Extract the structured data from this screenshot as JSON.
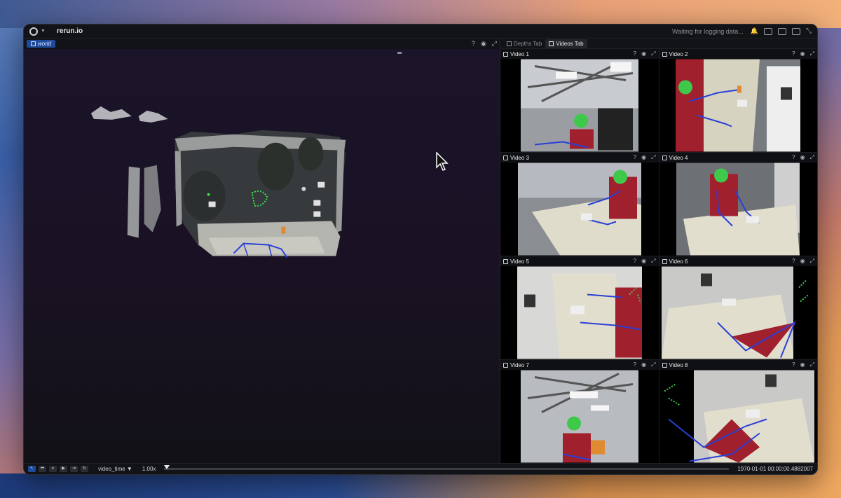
{
  "app": {
    "title": "rerun.io",
    "status": "Waiting for logging data..."
  },
  "world_view": {
    "tab_label": "world"
  },
  "tabs": [
    {
      "label": "Depths Tab",
      "active": false
    },
    {
      "label": "Videos Tab",
      "active": true
    }
  ],
  "videos": [
    {
      "label": "Video 1",
      "scene": "ceiling"
    },
    {
      "label": "Video 2",
      "scene": "side-table"
    },
    {
      "label": "Video 3",
      "scene": "front"
    },
    {
      "label": "Video 4",
      "scene": "front-right"
    },
    {
      "label": "Video 5",
      "scene": "corner"
    },
    {
      "label": "Video 6",
      "scene": "overhead"
    },
    {
      "label": "Video 7",
      "scene": "ceiling"
    },
    {
      "label": "Video 8",
      "scene": "overhead-arms"
    }
  ],
  "timeline": {
    "name": "video_time",
    "speed": "1.00x",
    "timestamp": "1970-01-01 00:00:00.4882007",
    "progress": 0.0
  },
  "colors": {
    "accent": "#1f4b9c",
    "keypoints": "#38e04a",
    "skeleton": "#2a3fd6"
  }
}
